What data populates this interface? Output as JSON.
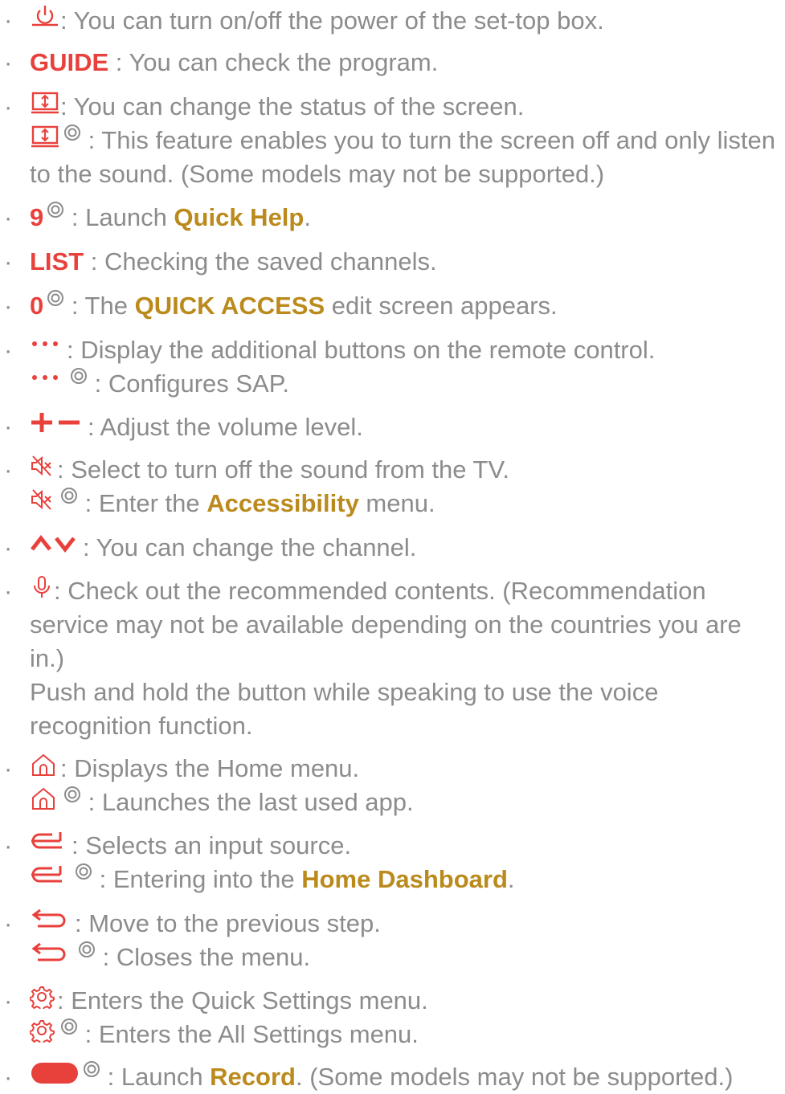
{
  "bullet": "·",
  "colors": {
    "key": "#e8413c",
    "highlight": "#bb8a1d",
    "text": "#8c8c8c"
  },
  "items": [
    {
      "icon": "power-icon",
      "text": ": You can turn on/off the power of the set-top box."
    },
    {
      "key": "GUIDE",
      "text": " : You can check the program."
    },
    {
      "icon": "screen-icon",
      "text": ": You can change the status of the screen.",
      "hold_text": ": This feature enables you to turn the screen off and only listen to the sound. (Some models may not be supported.)"
    },
    {
      "key": "9",
      "text_before": ": Launch ",
      "highlight": "Quick Help",
      "text_after": "."
    },
    {
      "key": "LIST",
      "text": " : Checking the saved channels."
    },
    {
      "key": "0",
      "text_before": ": The ",
      "highlight": "QUICK ACCESS",
      "text_after": " edit screen appears."
    },
    {
      "icon": "more-icon",
      "text": ": Display the additional buttons on the remote control.",
      "hold_text": ": Configures SAP."
    },
    {
      "icon": "volume-plus-minus-icon",
      "text": ": Adjust the volume level."
    },
    {
      "icon": "mute-icon",
      "text": ": Select to turn off the sound from the TV.",
      "hold_before": ": Enter the ",
      "hold_highlight": "Accessibility",
      "hold_after": " menu."
    },
    {
      "icon": "channel-up-down-icon",
      "text": ": You can change the channel."
    },
    {
      "icon": "microphone-icon",
      "text": ": Check out the recommended contents. (Recommendation service may not be available depending on the countries you are in.)",
      "extra_text": "Push and hold the button while speaking to use the voice recognition function."
    },
    {
      "icon": "home-icon",
      "text": ": Displays the Home menu.",
      "hold_text": ": Launches the last used app."
    },
    {
      "icon": "input-icon",
      "text": ": Selects an input source.",
      "hold_before": ": Entering into the ",
      "hold_highlight": "Home Dashboard",
      "hold_after": "."
    },
    {
      "icon": "back-icon",
      "text": ": Move to the previous step.",
      "hold_text": ": Closes the menu."
    },
    {
      "icon": "settings-icon",
      "text": ": Enters the Quick Settings menu.",
      "hold_text": ": Enters the All Settings menu."
    },
    {
      "icon": "record-icon",
      "text_before": ": Launch ",
      "highlight": "Record",
      "text_after": ". (Some models may not be supported.)"
    }
  ]
}
